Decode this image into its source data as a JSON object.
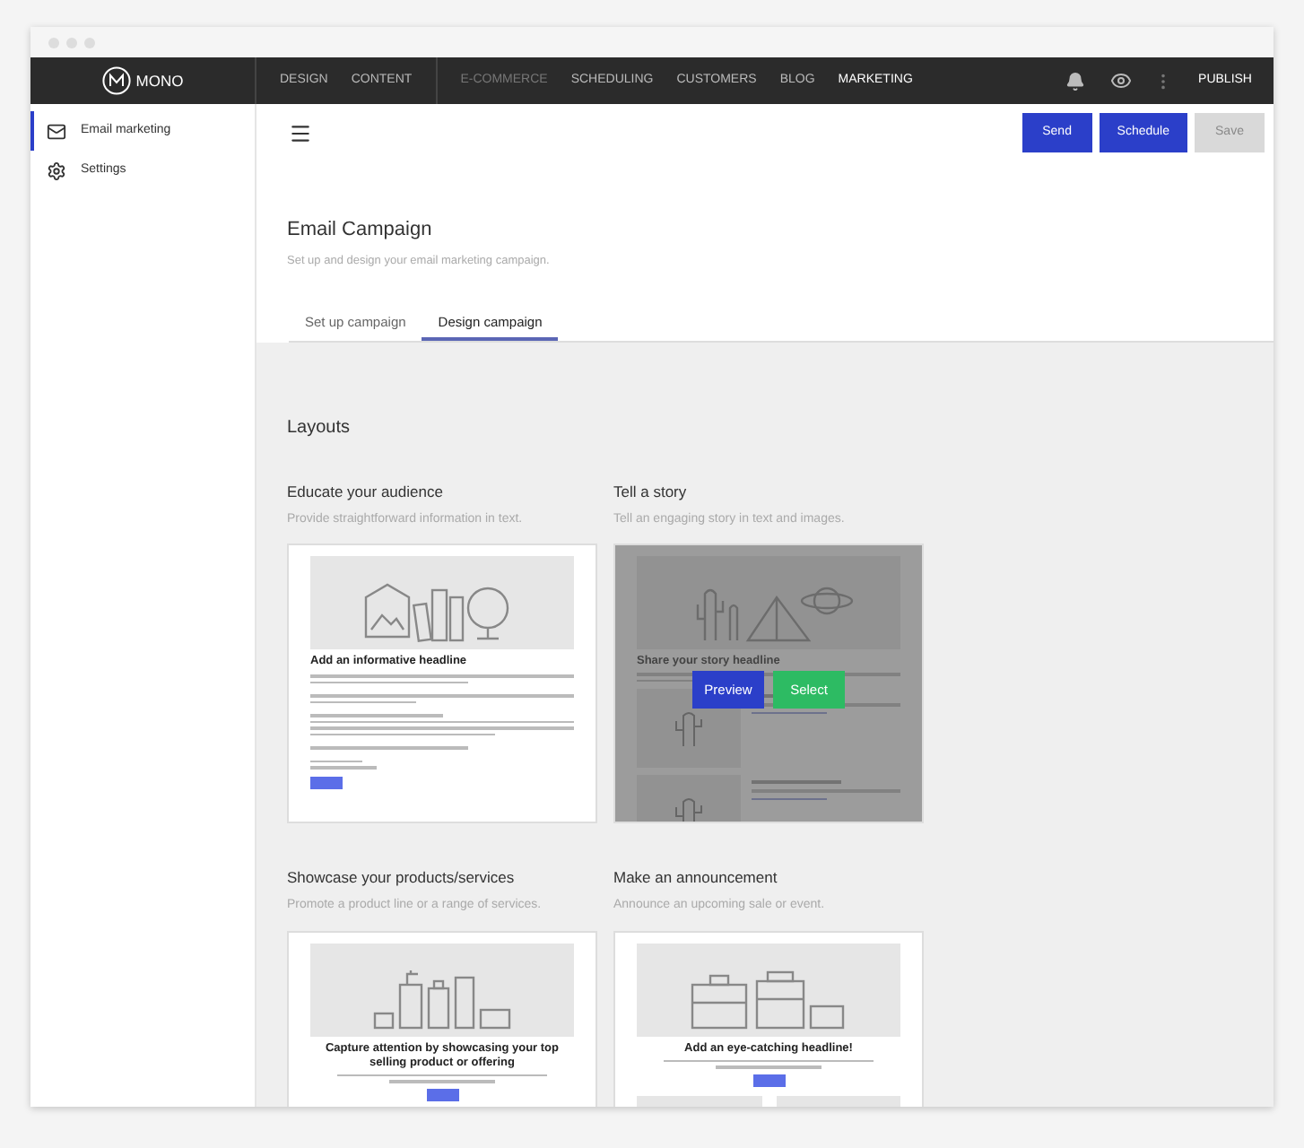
{
  "nav": {
    "logo": "MONO",
    "items": [
      {
        "label": "DESIGN",
        "selected": false,
        "disabled": false
      },
      {
        "label": "CONTENT",
        "selected": false,
        "disabled": false
      },
      {
        "label": "E-COMMERCE",
        "selected": false,
        "disabled": true
      },
      {
        "label": "SCHEDULING",
        "selected": false,
        "disabled": false
      },
      {
        "label": "CUSTOMERS",
        "selected": false,
        "disabled": false
      },
      {
        "label": "BLOG",
        "selected": false,
        "disabled": false
      },
      {
        "label": "MARKETING",
        "selected": true,
        "disabled": false
      }
    ],
    "publish": "PUBLISH"
  },
  "sidebar": {
    "items": [
      {
        "label": "Email marketing",
        "selected": true
      },
      {
        "label": "Settings",
        "selected": false
      }
    ]
  },
  "toolbar": {
    "buttons": [
      {
        "label": "Send",
        "disabled": false
      },
      {
        "label": "Schedule",
        "disabled": false
      },
      {
        "label": "Save",
        "disabled": true
      }
    ]
  },
  "header": {
    "title": "Email Campaign",
    "subtitle": "Set up and design your email marketing campaign."
  },
  "tabs": [
    {
      "label": "Set up campaign",
      "selected": false
    },
    {
      "label": "Design campaign",
      "selected": true
    }
  ],
  "layouts": {
    "title": "Layouts",
    "cards": [
      {
        "kind": "text",
        "title": "Educate your audience",
        "description": "Provide straightforward information in text.",
        "hovered": false,
        "preview": {
          "headline": "Add an informative headline"
        }
      },
      {
        "kind": "story",
        "title": "Tell a story",
        "description": "Tell an engaging story in text and images.",
        "hovered": true,
        "preview": {
          "headline": "Share your story headline"
        },
        "actions": [
          "Preview",
          "Select"
        ]
      },
      {
        "kind": "products",
        "title": "Showcase your products/services",
        "description": "Promote a product line or a range of services.",
        "hovered": false,
        "preview": {
          "headline": "Capture attention by showcasing your top selling product or offering"
        }
      },
      {
        "kind": "announcement",
        "title": "Make an announcement",
        "description": "Announce an upcoming sale or event.",
        "hovered": false,
        "preview": {
          "headline": "Add an eye-catching headline!"
        }
      }
    ]
  }
}
